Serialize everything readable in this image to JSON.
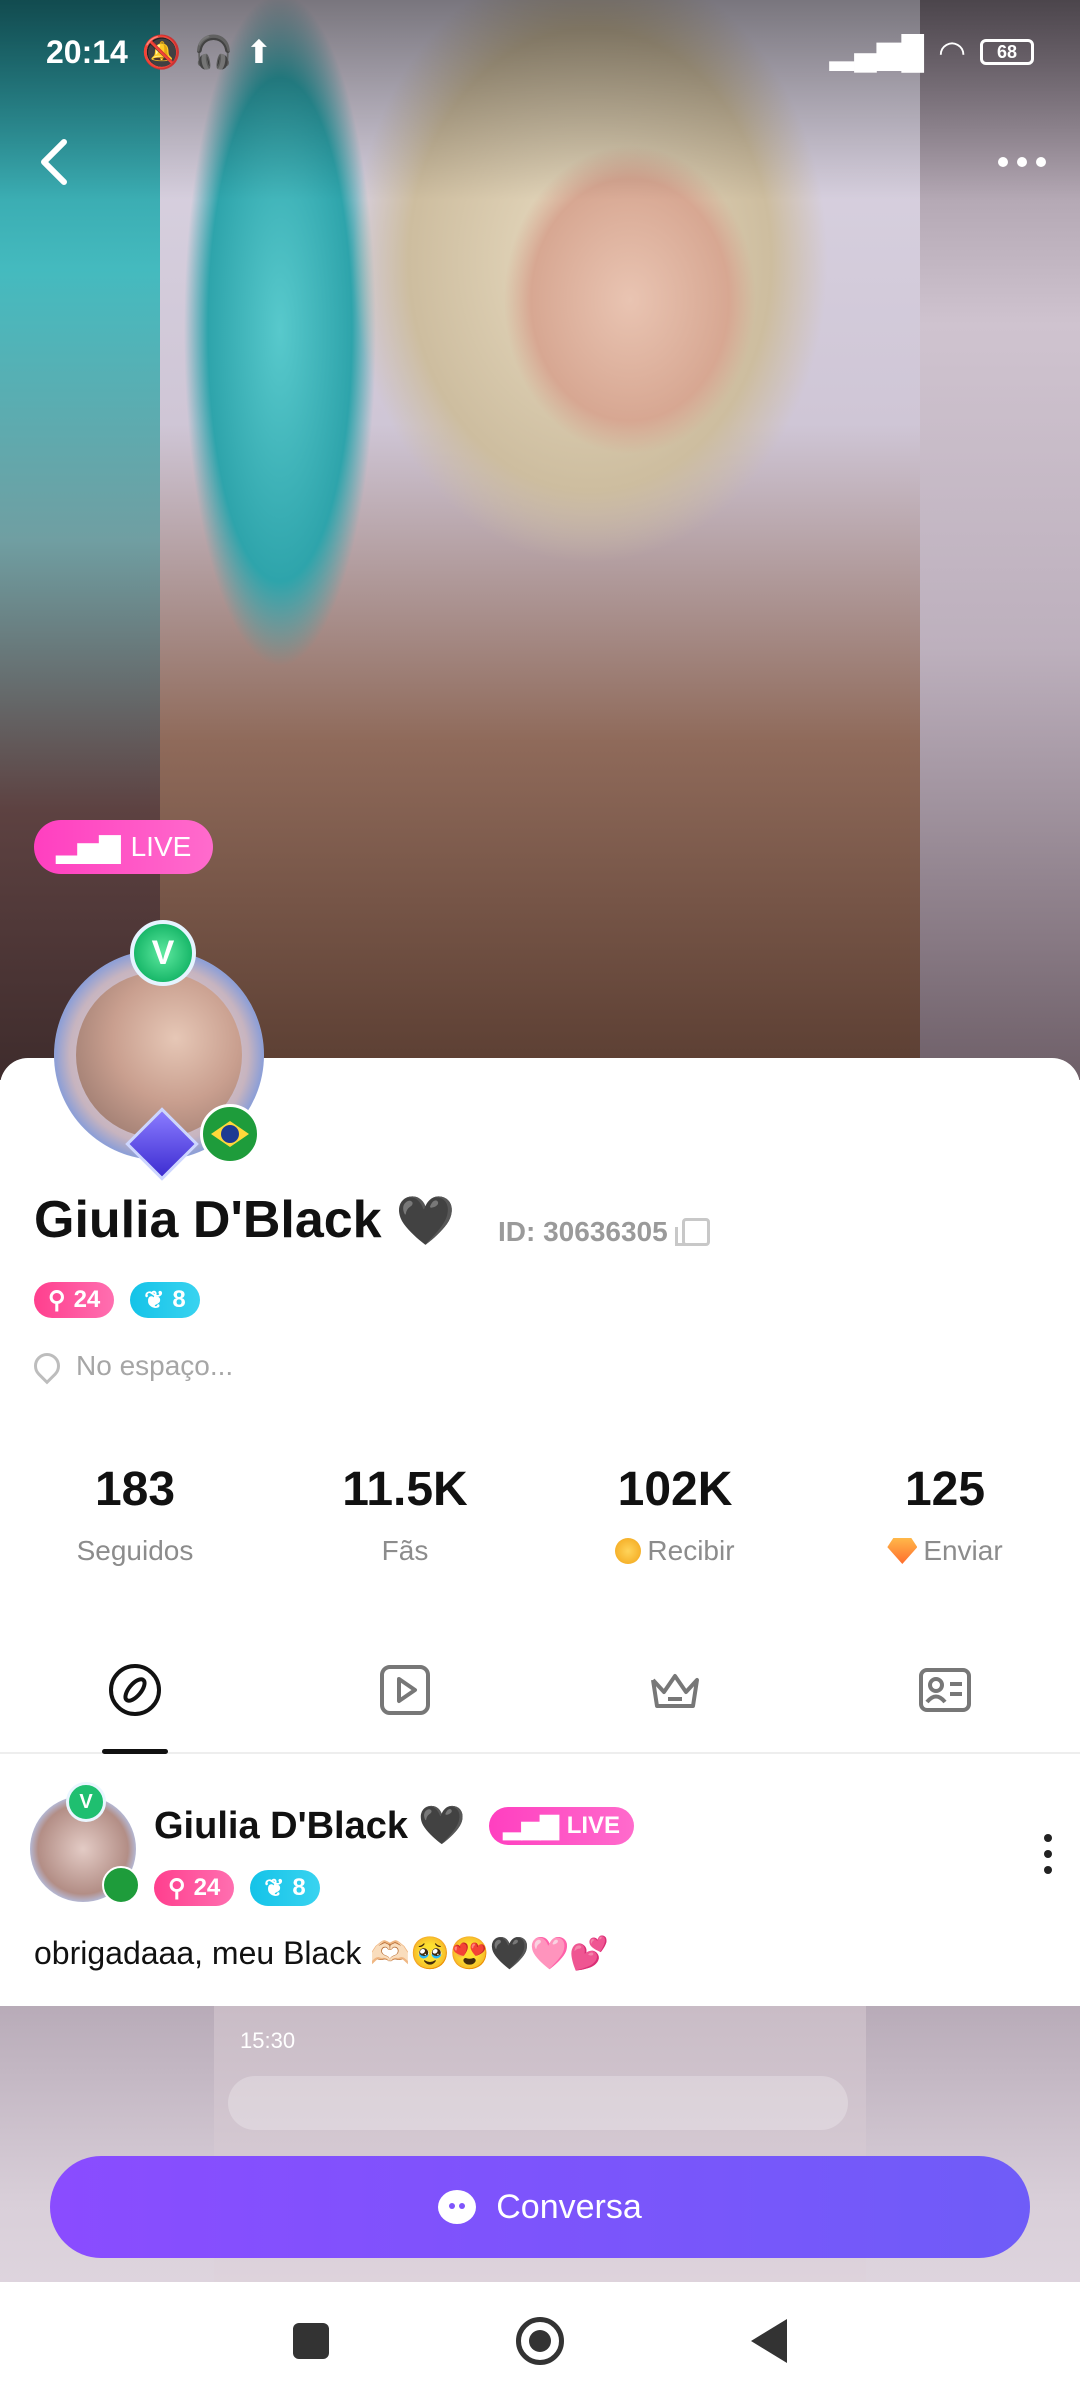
{
  "status_bar": {
    "time": "20:14",
    "battery": "68"
  },
  "hero": {
    "live_label": "LIVE"
  },
  "profile": {
    "name": "Giulia D'Black",
    "heart": "🖤",
    "id_text": "ID: 30636305",
    "badge_level": "24",
    "badge_plant": "8",
    "location": "No espaço...",
    "avatar_badge": "V"
  },
  "stats": [
    {
      "value": "183",
      "label": "Seguidos"
    },
    {
      "value": "11.5K",
      "label": "Fãs"
    },
    {
      "value": "102K",
      "label": "Recibir"
    },
    {
      "value": "125",
      "label": "Enviar"
    }
  ],
  "tabs": [
    "explore-icon",
    "video-icon",
    "crown-icon",
    "profile-card-icon"
  ],
  "post": {
    "author": "Giulia D'Black",
    "heart": "🖤",
    "live_label": "LIVE",
    "badge_level": "24",
    "badge_plant": "8",
    "text": "obrigadaaa, meu Black 🫶🏻🥹😍🖤🩷💕",
    "media_time": "15:30"
  },
  "chat_button": {
    "label": "Conversa"
  },
  "colors": {
    "accent": "#7b55fb",
    "live": "#ff3fc0",
    "pink_badge": "#ff3f8e",
    "cyan_badge": "#14c3e8"
  }
}
